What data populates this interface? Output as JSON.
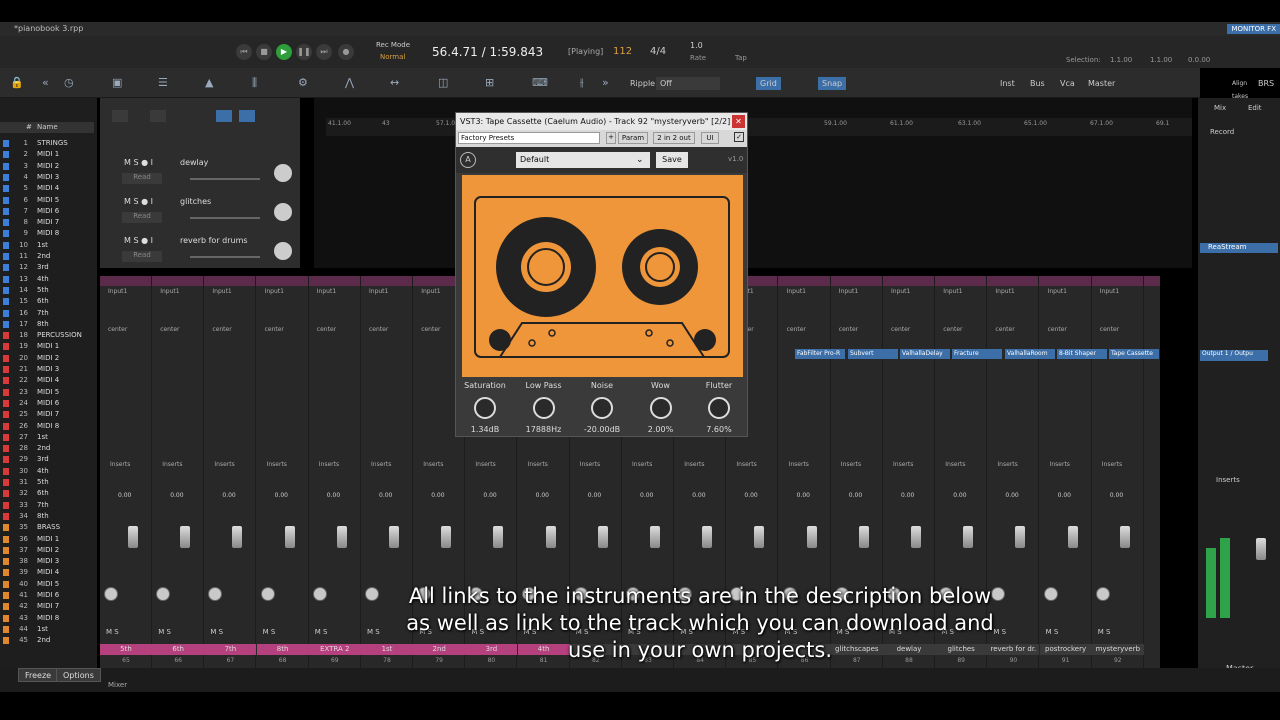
{
  "window": {
    "title": "*pianobook 3.rpp",
    "monitor": "MONITOR FX"
  },
  "transport": {
    "rec_mode": "Rec Mode",
    "rec_mode_value": "Normal",
    "time": "56.4.71 / 1:59.843",
    "status": "[Playing]",
    "bpm": "112",
    "timesig": "4/4",
    "rate_value": "1.0",
    "rate_label": "Rate",
    "tap_label": "Tap",
    "selection_label": "Selection:",
    "sel_start": "1.1.00",
    "sel_end": "1.1.00",
    "sel_len": "0.0.00"
  },
  "toolbar": {
    "ripple": "Ripple",
    "ripple_value": "Off",
    "grid": "Grid",
    "snap": "Snap",
    "inst": "Inst",
    "bus": "Bus",
    "vca": "Vca",
    "master": "Master",
    "align": "Align takes",
    "brs": "BRS"
  },
  "tracks": [
    {
      "n": "1",
      "l": "STRINGS",
      "c": "#3b7fd6"
    },
    {
      "n": "2",
      "l": "MIDI 1",
      "c": "#3b7fd6"
    },
    {
      "n": "3",
      "l": "MIDI 2",
      "c": "#3b7fd6"
    },
    {
      "n": "4",
      "l": "MIDI 3",
      "c": "#3b7fd6"
    },
    {
      "n": "5",
      "l": "MIDI 4",
      "c": "#3b7fd6"
    },
    {
      "n": "6",
      "l": "MIDI 5",
      "c": "#3b7fd6"
    },
    {
      "n": "7",
      "l": "MIDI 6",
      "c": "#3b7fd6"
    },
    {
      "n": "8",
      "l": "MIDI 7",
      "c": "#3b7fd6"
    },
    {
      "n": "9",
      "l": "MIDI 8",
      "c": "#3b7fd6"
    },
    {
      "n": "10",
      "l": "1st",
      "c": "#3b7fd6"
    },
    {
      "n": "11",
      "l": "2nd",
      "c": "#3b7fd6"
    },
    {
      "n": "12",
      "l": "3rd",
      "c": "#3b7fd6"
    },
    {
      "n": "13",
      "l": "4th",
      "c": "#3b7fd6"
    },
    {
      "n": "14",
      "l": "5th",
      "c": "#3b7fd6"
    },
    {
      "n": "15",
      "l": "6th",
      "c": "#3b7fd6"
    },
    {
      "n": "16",
      "l": "7th",
      "c": "#3b7fd6"
    },
    {
      "n": "17",
      "l": "8th",
      "c": "#3b7fd6"
    },
    {
      "n": "18",
      "l": "PERCUSSION",
      "c": "#d83a3a"
    },
    {
      "n": "19",
      "l": "MIDI 1",
      "c": "#d83a3a"
    },
    {
      "n": "20",
      "l": "MIDI 2",
      "c": "#d83a3a"
    },
    {
      "n": "21",
      "l": "MIDI 3",
      "c": "#d83a3a"
    },
    {
      "n": "22",
      "l": "MIDI 4",
      "c": "#d83a3a"
    },
    {
      "n": "23",
      "l": "MIDI 5",
      "c": "#d83a3a"
    },
    {
      "n": "24",
      "l": "MIDI 6",
      "c": "#d83a3a"
    },
    {
      "n": "25",
      "l": "MIDI 7",
      "c": "#d83a3a"
    },
    {
      "n": "26",
      "l": "MIDI 8",
      "c": "#d83a3a"
    },
    {
      "n": "27",
      "l": "1st",
      "c": "#d83a3a"
    },
    {
      "n": "28",
      "l": "2nd",
      "c": "#d83a3a"
    },
    {
      "n": "29",
      "l": "3rd",
      "c": "#d83a3a"
    },
    {
      "n": "30",
      "l": "4th",
      "c": "#d83a3a"
    },
    {
      "n": "31",
      "l": "5th",
      "c": "#d83a3a"
    },
    {
      "n": "32",
      "l": "6th",
      "c": "#d83a3a"
    },
    {
      "n": "33",
      "l": "7th",
      "c": "#d83a3a"
    },
    {
      "n": "34",
      "l": "8th",
      "c": "#d83a3a"
    },
    {
      "n": "35",
      "l": "BRASS",
      "c": "#e0872e"
    },
    {
      "n": "36",
      "l": "MIDI 1",
      "c": "#e0872e"
    },
    {
      "n": "37",
      "l": "MIDI 2",
      "c": "#e0872e"
    },
    {
      "n": "38",
      "l": "MIDI 3",
      "c": "#e0872e"
    },
    {
      "n": "39",
      "l": "MIDI 4",
      "c": "#e0872e"
    },
    {
      "n": "40",
      "l": "MIDI 5",
      "c": "#e0872e"
    },
    {
      "n": "41",
      "l": "MIDI 6",
      "c": "#e0872e"
    },
    {
      "n": "42",
      "l": "MIDI 7",
      "c": "#e0872e"
    },
    {
      "n": "43",
      "l": "MIDI 8",
      "c": "#e0872e"
    },
    {
      "n": "44",
      "l": "1st",
      "c": "#e0872e"
    },
    {
      "n": "45",
      "l": "2nd",
      "c": "#e0872e"
    }
  ],
  "tracklist_header": {
    "num": "#",
    "name": "Name"
  },
  "tcp": [
    {
      "name": "dewlay",
      "mode": "Read"
    },
    {
      "name": "glitches",
      "mode": "Read"
    },
    {
      "name": "reverb for drums",
      "mode": "Read"
    }
  ],
  "mixer_strips": [
    {
      "name": "5th",
      "num": "65",
      "pink": true
    },
    {
      "name": "6th",
      "num": "66",
      "pink": true
    },
    {
      "name": "7th",
      "num": "67",
      "pink": true
    },
    {
      "name": "8th",
      "num": "68",
      "pink": true
    },
    {
      "name": "EXTRA 2",
      "num": "69",
      "pink": true
    },
    {
      "name": "1st",
      "num": "78",
      "pink": true
    },
    {
      "name": "2nd",
      "num": "79",
      "pink": true
    },
    {
      "name": "3rd",
      "num": "80",
      "pink": true
    },
    {
      "name": "4th",
      "num": "81",
      "pink": true
    },
    {
      "name": "",
      "num": "82",
      "pink": false
    },
    {
      "name": "",
      "num": "83",
      "pink": false
    },
    {
      "name": "",
      "num": "84",
      "pink": false
    },
    {
      "name": "",
      "num": "85",
      "pink": false
    },
    {
      "name": "",
      "num": "86",
      "pink": false
    },
    {
      "name": "glitchscapes",
      "num": "87",
      "pink": false
    },
    {
      "name": "dewlay",
      "num": "88",
      "pink": false
    },
    {
      "name": "glitches",
      "num": "89",
      "pink": false
    },
    {
      "name": "reverb for dr.",
      "num": "90",
      "pink": false
    },
    {
      "name": "postrockery",
      "num": "91",
      "pink": false
    },
    {
      "name": "mysteryverb",
      "num": "92",
      "pink": false
    }
  ],
  "plugin": {
    "title": "VST3: Tape Cassette (Caelum Audio) - Track 92 \"mysteryverb\" [2/2]",
    "presets": "Factory Presets",
    "param": "Param",
    "io": "2 in 2 out",
    "ui": "UI",
    "preset_value": "Default",
    "save": "Save",
    "version": "v1.0",
    "knobs": [
      {
        "label": "Saturation",
        "value": "1.34dB"
      },
      {
        "label": "Low Pass",
        "value": "17888Hz"
      },
      {
        "label": "Noise",
        "value": "-20.00dB"
      },
      {
        "label": "Wow",
        "value": "2.00%"
      },
      {
        "label": "Flutter",
        "value": "7.60%"
      }
    ]
  },
  "fx": [
    "FabFilter Pro-R",
    "Subvert",
    "ValhallaDelay",
    "Fracture",
    "ValhallaRoom",
    "8-Bit Shaper",
    "Tape Cassette"
  ],
  "right": {
    "mix": "Mix",
    "edit": "Edit",
    "record": "Record",
    "reastream": "ReaStream",
    "output": "Output 1 / Outpu",
    "master": "Master",
    "inserts": "Inserts"
  },
  "bottom": {
    "freeze": "Freeze",
    "options": "Options",
    "mixer_tab": "Mixer"
  },
  "subtitle": "All links to the instruments are in the description below as well as link to the track which you can download and use in your own projects.",
  "ruler_marks": [
    "41.1.00",
    "43",
    "57.1.00",
    "59.1.00",
    "61.1.00",
    "63.1.00",
    "65.1.00",
    "67.1.00",
    "69.1"
  ]
}
